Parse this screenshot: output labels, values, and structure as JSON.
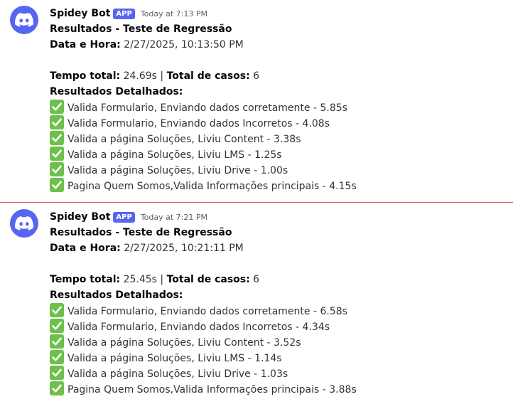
{
  "messages": [
    {
      "username": "Spidey Bot",
      "badge": "APP",
      "timestamp": "Today at 7:13 PM",
      "title": "Resultados - Teste de Regressão",
      "datetime_label": "Data e Hora:",
      "datetime_value": " 2/27/2025, 10:13:50 PM",
      "total_time_label": "Tempo total:",
      "total_time_value": " 24.69s | ",
      "total_cases_label": "Total de casos:",
      "total_cases_value": " 6",
      "details_label": "Resultados Detalhados:",
      "results": [
        "Valida Formulario, Enviando dados corretamente - 5.85s",
        "Valida Formulario, Enviando dados Incorretos - 4.08s",
        "Valida a página Soluções, Liviu Content - 3.38s",
        "Valida a página Soluções, Liviu LMS - 1.25s",
        "Valida a página Soluções, Liviu Drive - 1.00s",
        "Pagina Quem Somos,Valida Informações principais - 4.15s"
      ]
    },
    {
      "username": "Spidey Bot",
      "badge": "APP",
      "timestamp": "Today at 7:21 PM",
      "title": "Resultados - Teste de Regressão",
      "datetime_label": "Data e Hora:",
      "datetime_value": " 2/27/2025, 10:21:11 PM",
      "total_time_label": "Tempo total:",
      "total_time_value": " 25.45s | ",
      "total_cases_label": "Total de casos:",
      "total_cases_value": " 6",
      "details_label": "Resultados Detalhados:",
      "results": [
        "Valida Formulario, Enviando dados corretamente - 6.58s",
        "Valida Formulario, Enviando dados Incorretos - 4.34s",
        "Valida a página Soluções, Liviu Content - 3.52s",
        "Valida a página Soluções, Liviu LMS - 1.14s",
        "Valida a página Soluções, Liviu Drive - 1.03s",
        "Pagina Quem Somos,Valida Informações principais - 3.88s"
      ]
    }
  ],
  "icons": {
    "avatar": "discord-logo-icon",
    "result_check": "check-mark-button-icon"
  },
  "colors": {
    "avatar_bg": "#5865f2",
    "badge_bg": "#5865f2",
    "check_bg": "#6fbf4d",
    "divider": "#d9534f"
  }
}
